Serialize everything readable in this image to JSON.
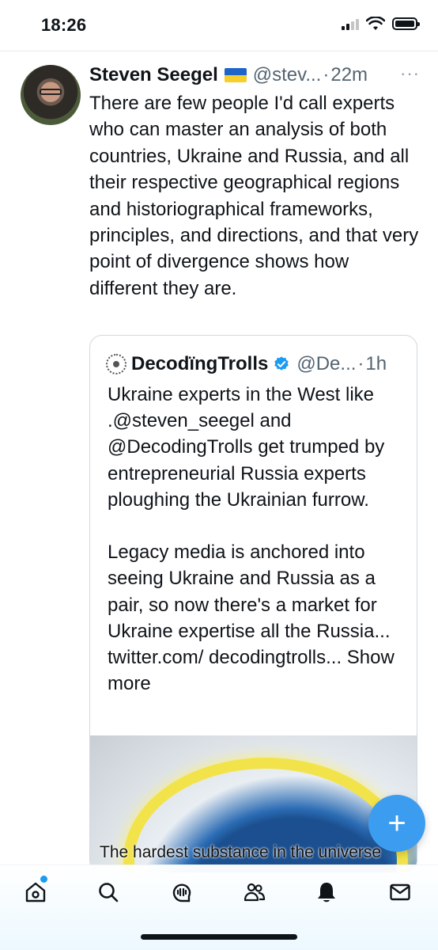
{
  "status_bar": {
    "time": "18:26"
  },
  "tweet": {
    "author_name": "Steven Seegel",
    "handle": "@stev...",
    "separator": "·",
    "time": "22m",
    "more": "···",
    "text": "There are few people I'd call experts who can master an analysis of both countries, Ukraine and Russia, and all their respective geographical regions and historiographical frameworks, principles, and directions, and that very point of divergence shows how different they are."
  },
  "quote": {
    "author_name": "DecodïngTrolls",
    "handle": "@De...",
    "separator": "·",
    "time": "1h",
    "paragraph1": "Ukraine experts in the West like .@steven_seegel and @DecodingTrolls get trumped by entrepreneurial Russia experts ploughing the Ukrainian furrow.",
    "paragraph2": "Legacy media is anchored into seeing Ukraine and Russia as a pair, so now there's a market for Ukraine expertise all the Russia... twitter.com/ decodingtrolls...",
    "show_more": "Show more",
    "media_caption": "The hardest substance in the universe"
  },
  "fab": {
    "label": "+"
  },
  "nav": {
    "items": [
      "home-icon",
      "search-icon",
      "spaces-icon",
      "communities-icon",
      "notifications-icon",
      "messages-icon"
    ]
  },
  "colors": {
    "accent": "#1d9bf0",
    "fab": "#3c9df0",
    "text": "#0f1419",
    "muted": "#536471"
  }
}
